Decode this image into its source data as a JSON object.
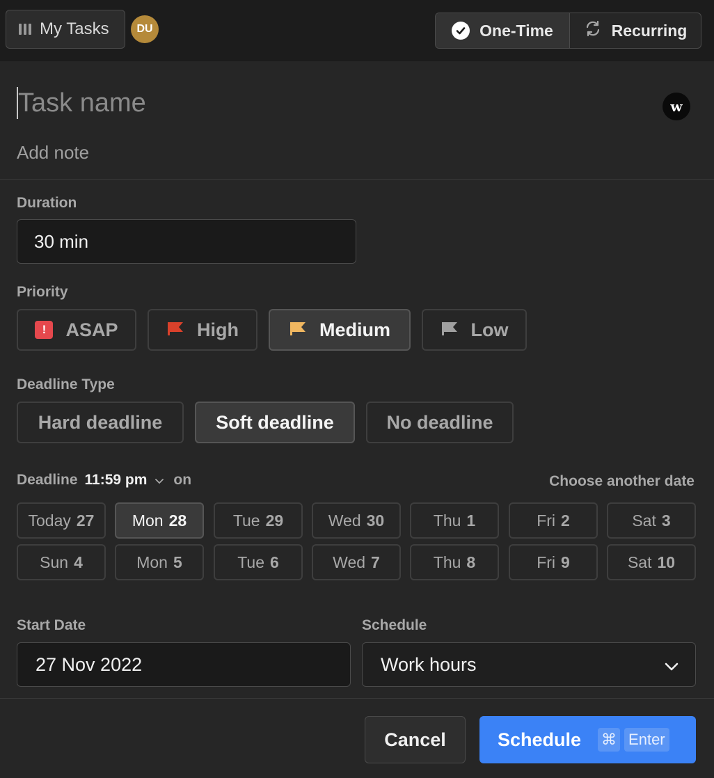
{
  "header": {
    "workspace_label": "My Tasks",
    "avatar_initials": "DU",
    "task_types": [
      {
        "label": "One-Time",
        "selected": true
      },
      {
        "label": "Recurring",
        "selected": false
      }
    ]
  },
  "task": {
    "name_placeholder": "Task name",
    "note_placeholder": "Add note"
  },
  "duration": {
    "label": "Duration",
    "value": "30 min"
  },
  "priority": {
    "label": "Priority",
    "options": [
      {
        "label": "ASAP",
        "selected": false
      },
      {
        "label": "High",
        "selected": false,
        "color": "#d9412b"
      },
      {
        "label": "Medium",
        "selected": true,
        "color": "#f0b760"
      },
      {
        "label": "Low",
        "selected": false,
        "color": "#a0a0a0"
      }
    ]
  },
  "deadline_type": {
    "label": "Deadline Type",
    "options": [
      {
        "label": "Hard deadline",
        "selected": false
      },
      {
        "label": "Soft deadline",
        "selected": true
      },
      {
        "label": "No deadline",
        "selected": false
      }
    ]
  },
  "deadline": {
    "label": "Deadline",
    "time": "11:59 pm",
    "on_label": "on",
    "choose_another": "Choose another date",
    "days": [
      {
        "name": "Today",
        "num": "27"
      },
      {
        "name": "Mon",
        "num": "28",
        "selected": true
      },
      {
        "name": "Tue",
        "num": "29"
      },
      {
        "name": "Wed",
        "num": "30"
      },
      {
        "name": "Thu",
        "num": "1"
      },
      {
        "name": "Fri",
        "num": "2"
      },
      {
        "name": "Sat",
        "num": "3"
      },
      {
        "name": "Sun",
        "num": "4"
      },
      {
        "name": "Mon",
        "num": "5"
      },
      {
        "name": "Tue",
        "num": "6"
      },
      {
        "name": "Wed",
        "num": "7"
      },
      {
        "name": "Thu",
        "num": "8"
      },
      {
        "name": "Fri",
        "num": "9"
      },
      {
        "name": "Sat",
        "num": "10"
      }
    ]
  },
  "start_date": {
    "label": "Start Date",
    "value": "27 Nov 2022"
  },
  "schedule": {
    "label": "Schedule",
    "value": "Work hours"
  },
  "footer": {
    "cancel_label": "Cancel",
    "schedule_label": "Schedule",
    "shortcut_key1": "⌘",
    "shortcut_key2": "Enter"
  },
  "colors": {
    "accent": "#3b82f6",
    "asap": "#e5484d",
    "avatar": "#b58a3a"
  }
}
